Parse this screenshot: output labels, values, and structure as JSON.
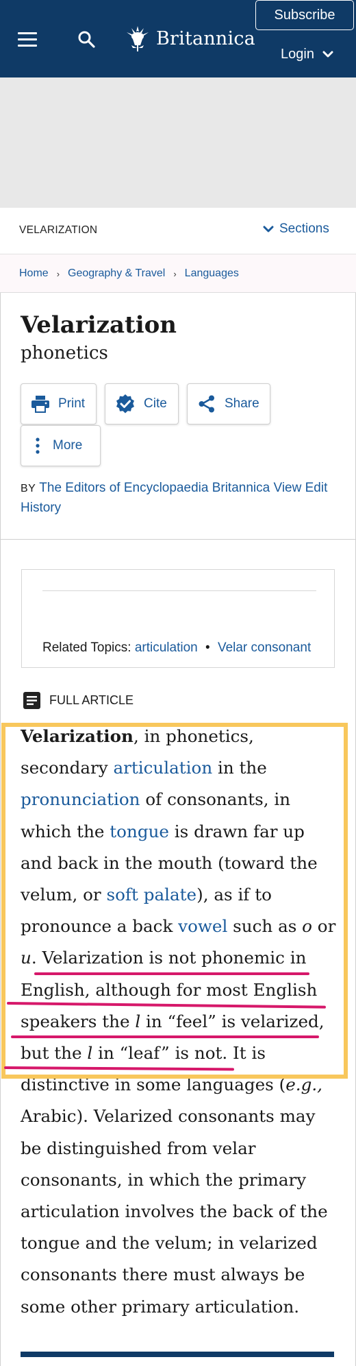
{
  "header": {
    "menu_icon": "hamburger-menu-icon",
    "search_icon": "search-icon",
    "logo_text": "Britannica",
    "subscribe_label": "Subscribe",
    "login_label": "Login",
    "bg_color": "#0f3a66"
  },
  "section_bar": {
    "label": "VELARIZATION",
    "sections_label": "Sections"
  },
  "breadcrumb": {
    "items": [
      "Home",
      "Geography & Travel",
      "Languages"
    ]
  },
  "article_header": {
    "title": "Velarization",
    "subtitle": "phonetics",
    "actions": {
      "print": "Print",
      "cite": "Cite",
      "share": "Share",
      "more": "More"
    },
    "byline": {
      "by": "BY",
      "author": "The Editors of Encyclopaedia Britannica",
      "history": "View Edit History"
    }
  },
  "related": {
    "label": "Related Topics:",
    "topics": [
      "articulation",
      "Velar consonant"
    ]
  },
  "full_article_label": "FULL ARTICLE",
  "article": {
    "term": "Velarization",
    "t1": ", in phonetics, secondary ",
    "link_articulation": "articulation",
    "t2": " in the ",
    "link_pronunciation": "pronunciation",
    "t3": " of consonants, in which the ",
    "link_tongue": "tongue",
    "t4": " is drawn far up and back in the mouth (toward the velum, or ",
    "link_soft_palate": "soft palate",
    "t5": "), as if to pronounce a back ",
    "link_vowel": "vowel",
    "t6": " such as ",
    "i_o": "o",
    "t7": " or ",
    "i_u": "u",
    "t8": ". Velarization is not phonemic in English, although for most English speakers the ",
    "i_l1": "l",
    "t9": " in “feel” is velarized, but the ",
    "i_l2": "l",
    "t10": " in “leaf” is not. It is distinctive in some languages (",
    "i_eg": "e.g.,",
    "t11": " Arabic). Velarized consonants may be distinguished from velar consonants, in which the primary articulation involves the back of the tongue and the velum; in velarized consonants there must always be some other primary articulation."
  },
  "annotation_colors": {
    "highlight_box": "#f8c75c",
    "underline": "#d6186a"
  }
}
